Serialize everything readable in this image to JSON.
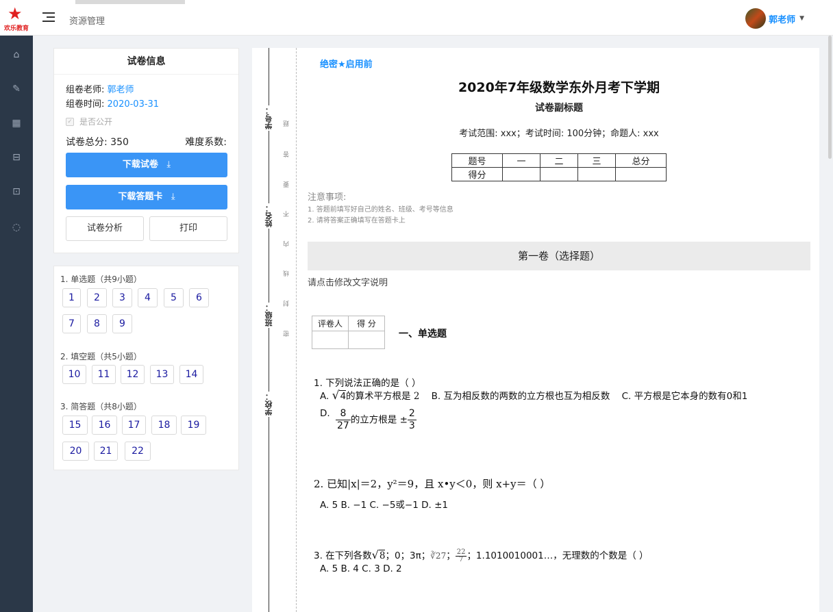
{
  "header": {
    "logo_text": "欢乐教育",
    "breadcrumb": "资源管理",
    "user_name": "郭老师",
    "caret": "▼"
  },
  "sidebar": {
    "items": [
      {
        "icon": "home-icon",
        "glyph": "⌂"
      },
      {
        "icon": "edit-icon",
        "glyph": "✎"
      },
      {
        "icon": "building-icon",
        "glyph": "▦"
      },
      {
        "icon": "inbox-icon",
        "glyph": "⊟"
      },
      {
        "icon": "board-icon",
        "glyph": "⊡"
      },
      {
        "icon": "user-icon",
        "glyph": "◌"
      }
    ]
  },
  "info": {
    "title": "试卷信息",
    "teacher_label": "组卷老师:",
    "teacher": "郭老师",
    "time_label": "组卷时间:",
    "time": "2020-03-31",
    "public_label": "是否公开",
    "total_label": "试卷总分:",
    "total": "350",
    "difficulty_label": "难度系数:",
    "download_paper": "下载试卷",
    "download_card": "下载答题卡",
    "analysis": "试卷分析",
    "print": "打印"
  },
  "qnav": {
    "sections": [
      {
        "title": "1. 单选题（共9小题）",
        "items": [
          "1",
          "2",
          "3",
          "4",
          "5",
          "6",
          "7",
          "8",
          "9"
        ]
      },
      {
        "title": "2. 填空题（共5小题）",
        "items": [
          "10",
          "11",
          "12",
          "13",
          "14"
        ]
      },
      {
        "title": "3. 简答题（共8小题）",
        "items": [
          "15",
          "16",
          "17",
          "18",
          "19",
          "20",
          "21",
          "22"
        ]
      }
    ]
  },
  "binding": {
    "labels": [
      "学号：",
      "姓名：",
      "班级：",
      "学校："
    ],
    "dash_chars": [
      "题",
      "答",
      "要",
      "不",
      "内",
      "线",
      "封",
      "密"
    ]
  },
  "paper": {
    "secret": "绝密★启用前",
    "title": "2020年7年级数学东外月考下学期",
    "subtitle": "试卷副标题",
    "meta": "考试范围: xxx；考试时间: 100分钟；命题人: xxx",
    "score_table": {
      "row1": [
        "题号",
        "一",
        "二",
        "三",
        "总分"
      ],
      "row2_label": "得分"
    },
    "notes_title": "注意事项:",
    "notes": [
      "1. 答题前填写好自己的姓名、班级、考号等信息",
      "2. 请将答案正确填写在答题卡上"
    ],
    "section_title": "第一卷（选择题）",
    "edit_hint": "请点击修改文字说明",
    "grader_headers": [
      "评卷人",
      "得 分"
    ],
    "qtype": "一、单选题",
    "q1": {
      "stem": "1.  下列说法正确的是（      ）",
      "a_pre": "A.  ",
      "a_rad": "4",
      "a_post": "的算术平方根是",
      "a_val": "2",
      "b": "B.  互为相反数的两数的立方根也互为相反数",
      "c": "C.  平方根是它本身的数有0和1",
      "d_pre": "D.",
      "d_num": "8",
      "d_den": "27",
      "d_mid": "的立方根是",
      "d_pm": "±",
      "d_num2": "2",
      "d_den2": "3"
    },
    "q2": {
      "stem": "2.  已知|x|＝2，y²＝9，且 x•y＜0，则 x+y＝（       ）",
      "options": "A.  5  B.  −1  C.  −5或−1  D.  ±1"
    },
    "q3": {
      "stem_pre": "3.  在下列各数",
      "sqrt8": "8",
      "stem_mid": "；0；3π；",
      "cbrt": "∛27",
      "frac_num": "22",
      "frac_den": "7",
      "stem_post": "；1.1010010001…，无理数的个数是（      ）",
      "options": "A.  5  B.  4  C.  3  D.  2"
    }
  }
}
